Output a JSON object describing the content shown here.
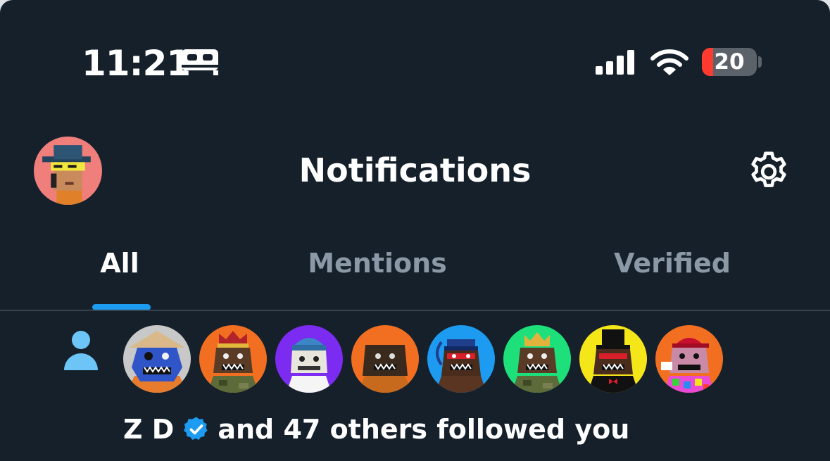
{
  "status_bar": {
    "time": "11:21",
    "battery_level": "20",
    "battery_fraction": 0.2,
    "icons": [
      "bed-icon",
      "cellular-signal-icon",
      "wifi-icon",
      "battery-icon"
    ]
  },
  "header": {
    "title": "Notifications",
    "profile_icon": "profile-avatar",
    "settings_icon": "gear-icon"
  },
  "tabs": [
    {
      "label": "All",
      "active": true
    },
    {
      "label": "Mentions",
      "active": false
    },
    {
      "label": "Verified",
      "active": false
    }
  ],
  "notification": {
    "type_icon": "person-icon",
    "name": "Z D",
    "verified_icon": "verified-badge-icon",
    "message": "and 47 others followed you",
    "avatar_colors": [
      "#c8c8c8",
      "#f26f22",
      "#7b2cf0",
      "#f26f22",
      "#1d9bf0",
      "#1ee07a",
      "#f5e61a",
      "#f26f22"
    ]
  },
  "colors": {
    "background": "#15202b",
    "accent": "#1d9bf0",
    "text_primary": "#ffffff",
    "text_secondary": "#8b98a5",
    "person_icon": "#6cc4f7",
    "battery_low": "#ff3b30"
  }
}
